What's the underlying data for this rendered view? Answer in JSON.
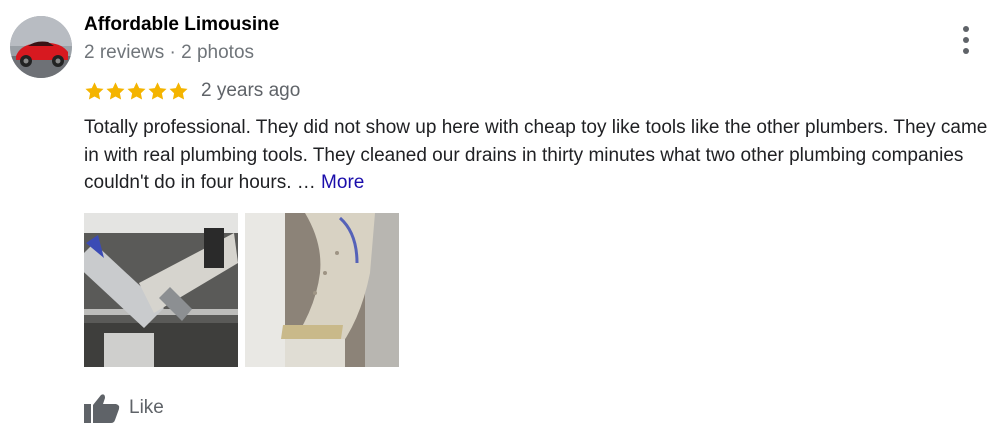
{
  "review": {
    "author": "Affordable Limousine",
    "meta": "2 reviews · 2 photos",
    "rating": 5,
    "rating_max": 5,
    "time": "2 years ago",
    "text": "Totally professional. They did not show up here with cheap toy like tools like the other plumbers. They came in with real plumbing tools. They cleaned our drains in thirty minutes what two other plumbing companies couldn't do in four hours. …",
    "more_label": "More",
    "like_label": "Like"
  },
  "photos": [
    {
      "icon": "pipe-photo-icon"
    },
    {
      "icon": "pipe-elbow-photo-icon"
    }
  ],
  "icons": {
    "avatar": "red-sports-car-avatar",
    "menu": "more-vertical-icon",
    "star": "star-icon",
    "like": "thumbs-up-icon"
  },
  "colors": {
    "star": "#f4b400",
    "more_link": "#1a0dab",
    "secondary_text": "#70757a"
  }
}
